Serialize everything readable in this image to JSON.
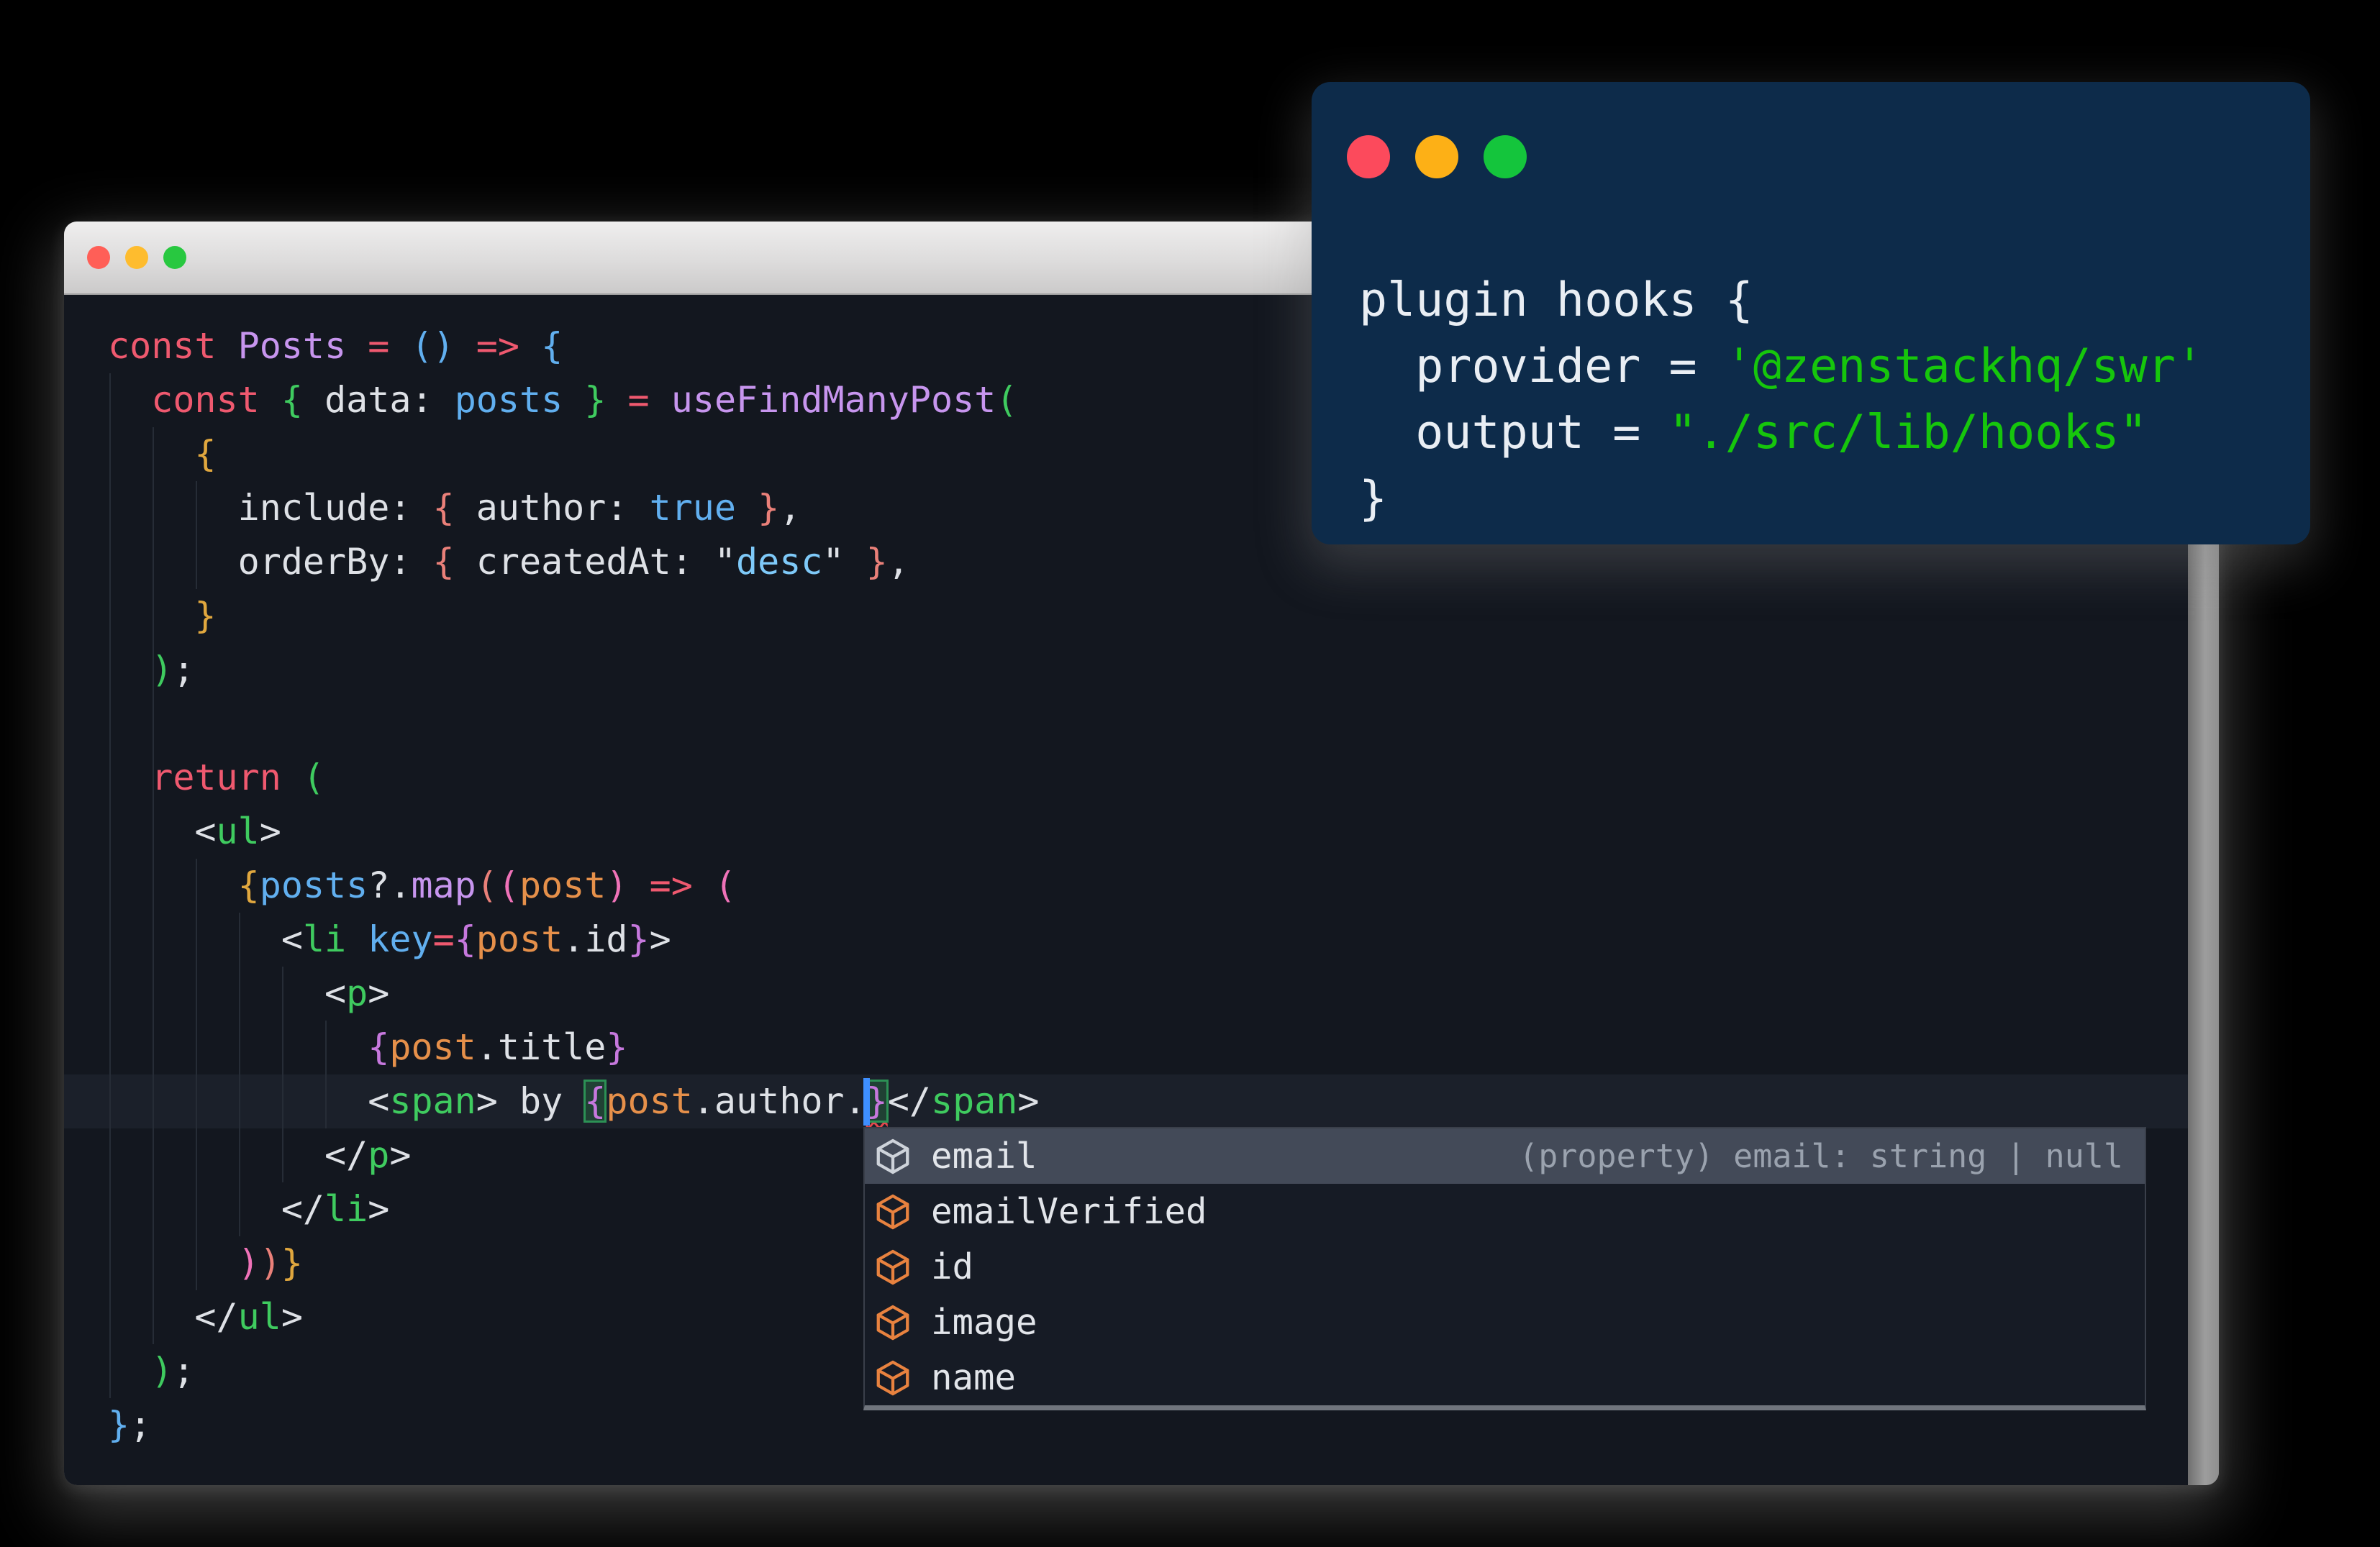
{
  "palette": {
    "red": "#ef596f",
    "purple": "#c795ee",
    "blue": "#61afef",
    "orange": "#e6904a",
    "white": "#dee1e6",
    "paleblue": "#7ec9f8",
    "green": "#3fcb5f",
    "gold": "#e0a73e",
    "salmon": "#ea8079",
    "pink": "#ef72b8",
    "vpurple": "#c678dd",
    "cursor": "#3e8fff",
    "squiggle": "#e5484d",
    "bracket_match_border": "#2c9155",
    "editor_bg": "#13171f",
    "line_highlight": "#1b202a",
    "suggest_bg": "#161b25",
    "suggest_selected_bg": "#434a58",
    "icon_orange": "#e8823f",
    "icon_selected": "#ced3da",
    "overlay_bg": "#0d2b4a",
    "overlay_green": "#16c60c",
    "overlay_white": "#e9eef4"
  },
  "main_window": {
    "traffic_lights": [
      {
        "name": "close",
        "color": "#ff5f57"
      },
      {
        "name": "minimize",
        "color": "#febc2e"
      },
      {
        "name": "zoom",
        "color": "#28c840"
      }
    ]
  },
  "editor": {
    "cursor": {
      "line": 14,
      "col": 35
    },
    "lines": [
      {
        "segs": [
          {
            "c": "red",
            "t": "const "
          },
          {
            "c": "purple",
            "t": "Posts "
          },
          {
            "c": "red",
            "t": "= "
          },
          {
            "c": "blue",
            "t": "()"
          },
          {
            "c": "white",
            "t": " "
          },
          {
            "c": "red",
            "t": "=> "
          },
          {
            "c": "blue",
            "t": "{"
          }
        ]
      },
      {
        "segs": [
          {
            "c": "white",
            "t": "  "
          },
          {
            "c": "red",
            "t": "const "
          },
          {
            "c": "green",
            "t": "{ "
          },
          {
            "c": "white",
            "t": "data: "
          },
          {
            "c": "blue",
            "t": "posts"
          },
          {
            "c": "white",
            "t": " "
          },
          {
            "c": "green",
            "t": "} "
          },
          {
            "c": "red",
            "t": "= "
          },
          {
            "c": "purple",
            "t": "useFindManyPost"
          },
          {
            "c": "green",
            "t": "("
          }
        ]
      },
      {
        "segs": [
          {
            "c": "white",
            "t": "    "
          },
          {
            "c": "gold",
            "t": "{"
          }
        ]
      },
      {
        "segs": [
          {
            "c": "white",
            "t": "      include: "
          },
          {
            "c": "salmon",
            "t": "{ "
          },
          {
            "c": "white",
            "t": "author: "
          },
          {
            "c": "blue",
            "t": "true"
          },
          {
            "c": "white",
            "t": " "
          },
          {
            "c": "salmon",
            "t": "}"
          },
          {
            "c": "white",
            "t": ","
          }
        ]
      },
      {
        "segs": [
          {
            "c": "white",
            "t": "      orderBy: "
          },
          {
            "c": "salmon",
            "t": "{ "
          },
          {
            "c": "white",
            "t": "createdAt: \""
          },
          {
            "c": "paleblue",
            "t": "desc"
          },
          {
            "c": "white",
            "t": "\" "
          },
          {
            "c": "salmon",
            "t": "}"
          },
          {
            "c": "white",
            "t": ","
          }
        ]
      },
      {
        "segs": [
          {
            "c": "white",
            "t": "    "
          },
          {
            "c": "gold",
            "t": "}"
          }
        ]
      },
      {
        "segs": [
          {
            "c": "white",
            "t": "  "
          },
          {
            "c": "green",
            "t": ")"
          },
          {
            "c": "white",
            "t": ";"
          }
        ]
      },
      {
        "segs": []
      },
      {
        "segs": [
          {
            "c": "white",
            "t": "  "
          },
          {
            "c": "red",
            "t": "return "
          },
          {
            "c": "green",
            "t": "("
          }
        ]
      },
      {
        "segs": [
          {
            "c": "white",
            "t": "    <"
          },
          {
            "c": "green",
            "t": "ul"
          },
          {
            "c": "white",
            "t": ">"
          }
        ]
      },
      {
        "segs": [
          {
            "c": "white",
            "t": "      "
          },
          {
            "c": "gold",
            "t": "{"
          },
          {
            "c": "blue",
            "t": "posts"
          },
          {
            "c": "white",
            "t": "?."
          },
          {
            "c": "purple",
            "t": "map"
          },
          {
            "c": "salmon",
            "t": "("
          },
          {
            "c": "pink",
            "t": "("
          },
          {
            "c": "orange",
            "t": "post"
          },
          {
            "c": "pink",
            "t": ")"
          },
          {
            "c": "white",
            "t": " "
          },
          {
            "c": "red",
            "t": "=> "
          },
          {
            "c": "pink",
            "t": "("
          }
        ]
      },
      {
        "segs": [
          {
            "c": "white",
            "t": "        <"
          },
          {
            "c": "green",
            "t": "li"
          },
          {
            "c": "white",
            "t": " "
          },
          {
            "c": "blue",
            "t": "key"
          },
          {
            "c": "red",
            "t": "="
          },
          {
            "c": "vpurple",
            "t": "{"
          },
          {
            "c": "orange",
            "t": "post"
          },
          {
            "c": "white",
            "t": ".id"
          },
          {
            "c": "vpurple",
            "t": "}"
          },
          {
            "c": "white",
            "t": ">"
          }
        ]
      },
      {
        "segs": [
          {
            "c": "white",
            "t": "          <"
          },
          {
            "c": "green",
            "t": "p"
          },
          {
            "c": "white",
            "t": ">"
          }
        ]
      },
      {
        "segs": [
          {
            "c": "white",
            "t": "            "
          },
          {
            "c": "vpurple",
            "t": "{"
          },
          {
            "c": "orange",
            "t": "post"
          },
          {
            "c": "white",
            "t": ".title"
          },
          {
            "c": "vpurple",
            "t": "}"
          }
        ]
      },
      {
        "segs": [
          {
            "c": "white",
            "t": "            <"
          },
          {
            "c": "green",
            "t": "span"
          },
          {
            "c": "white",
            "t": "> by "
          },
          {
            "c": "vpurple",
            "t": "{",
            "match": true
          },
          {
            "c": "orange",
            "t": "post"
          },
          {
            "c": "white",
            "t": ".author."
          },
          {
            "cursor": true
          },
          {
            "c": "vpurple",
            "t": "}",
            "match": true,
            "squiggle": true
          },
          {
            "c": "white",
            "t": "</"
          },
          {
            "c": "green",
            "t": "span"
          },
          {
            "c": "white",
            "t": ">"
          }
        ]
      },
      {
        "segs": [
          {
            "c": "white",
            "t": "          </"
          },
          {
            "c": "green",
            "t": "p"
          },
          {
            "c": "white",
            "t": ">"
          }
        ]
      },
      {
        "segs": [
          {
            "c": "white",
            "t": "        </"
          },
          {
            "c": "green",
            "t": "li"
          },
          {
            "c": "white",
            "t": ">"
          }
        ]
      },
      {
        "segs": [
          {
            "c": "white",
            "t": "      "
          },
          {
            "c": "pink",
            "t": ")"
          },
          {
            "c": "salmon",
            "t": ")"
          },
          {
            "c": "gold",
            "t": "}"
          }
        ]
      },
      {
        "segs": [
          {
            "c": "white",
            "t": "    </"
          },
          {
            "c": "green",
            "t": "ul"
          },
          {
            "c": "white",
            "t": ">"
          }
        ]
      },
      {
        "segs": [
          {
            "c": "white",
            "t": "  "
          },
          {
            "c": "green",
            "t": ")"
          },
          {
            "c": "white",
            "t": ";"
          }
        ]
      },
      {
        "segs": [
          {
            "c": "blue",
            "t": "}"
          },
          {
            "c": "white",
            "t": ";"
          }
        ]
      }
    ]
  },
  "suggest": {
    "selected_index": 0,
    "detail": "(property) email: string | null",
    "items": [
      {
        "label": "email"
      },
      {
        "label": "emailVerified"
      },
      {
        "label": "id"
      },
      {
        "label": "image"
      },
      {
        "label": "name"
      }
    ]
  },
  "overlay_window": {
    "traffic_lights": [
      {
        "name": "close",
        "color": "#fc4a5c"
      },
      {
        "name": "minimize",
        "color": "#fdb016"
      },
      {
        "name": "zoom",
        "color": "#14c53c"
      }
    ],
    "lines": [
      [
        {
          "c": "owhite",
          "t": "plugin hooks {"
        }
      ],
      [
        {
          "c": "owhite",
          "t": "  provider = "
        },
        {
          "c": "ogreen",
          "t": "'@zenstackhq/swr'"
        }
      ],
      [
        {
          "c": "owhite",
          "t": "  output = "
        },
        {
          "c": "ogreen",
          "t": "\"./src/lib/hooks\""
        }
      ],
      [
        {
          "c": "owhite",
          "t": "}"
        }
      ]
    ]
  }
}
